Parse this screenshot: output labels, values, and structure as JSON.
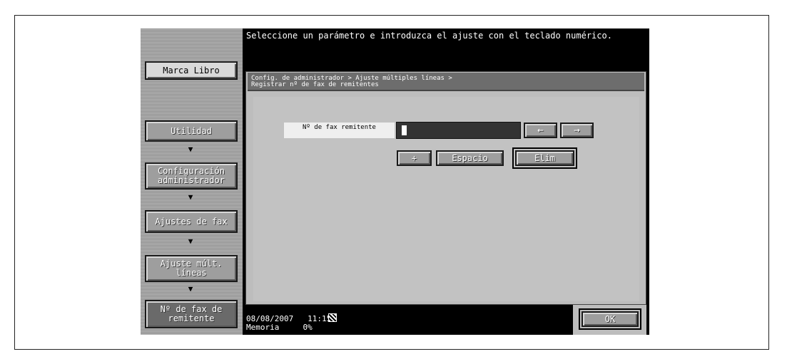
{
  "header": {
    "message": "Seleccione un parámetro e introduzca el ajuste con el teclado numérico."
  },
  "sidebar": {
    "bookmark": "Marca Libro",
    "steps": [
      {
        "label": "Utilidad"
      },
      {
        "label": "Configuración administrador"
      },
      {
        "label": "Ajustes de fax"
      },
      {
        "label": "Ajuste múlt. líneas"
      },
      {
        "label": "Nº de fax de remitente"
      }
    ]
  },
  "breadcrumb": {
    "line1": "Config. de administrador > Ajuste múltiples líneas >",
    "line2": "Registrar nº de fax de remitentes"
  },
  "form": {
    "fax_label": "Nº de fax remitente",
    "fax_value": "",
    "left_arrow": "←",
    "right_arrow": "→",
    "plus": "+",
    "space": "Espacio",
    "delete": "Elim"
  },
  "footer": {
    "date": "08/08/2007",
    "time": "11:15",
    "memory_label": "Memoria",
    "memory_value": "0%",
    "ok": "OK"
  }
}
